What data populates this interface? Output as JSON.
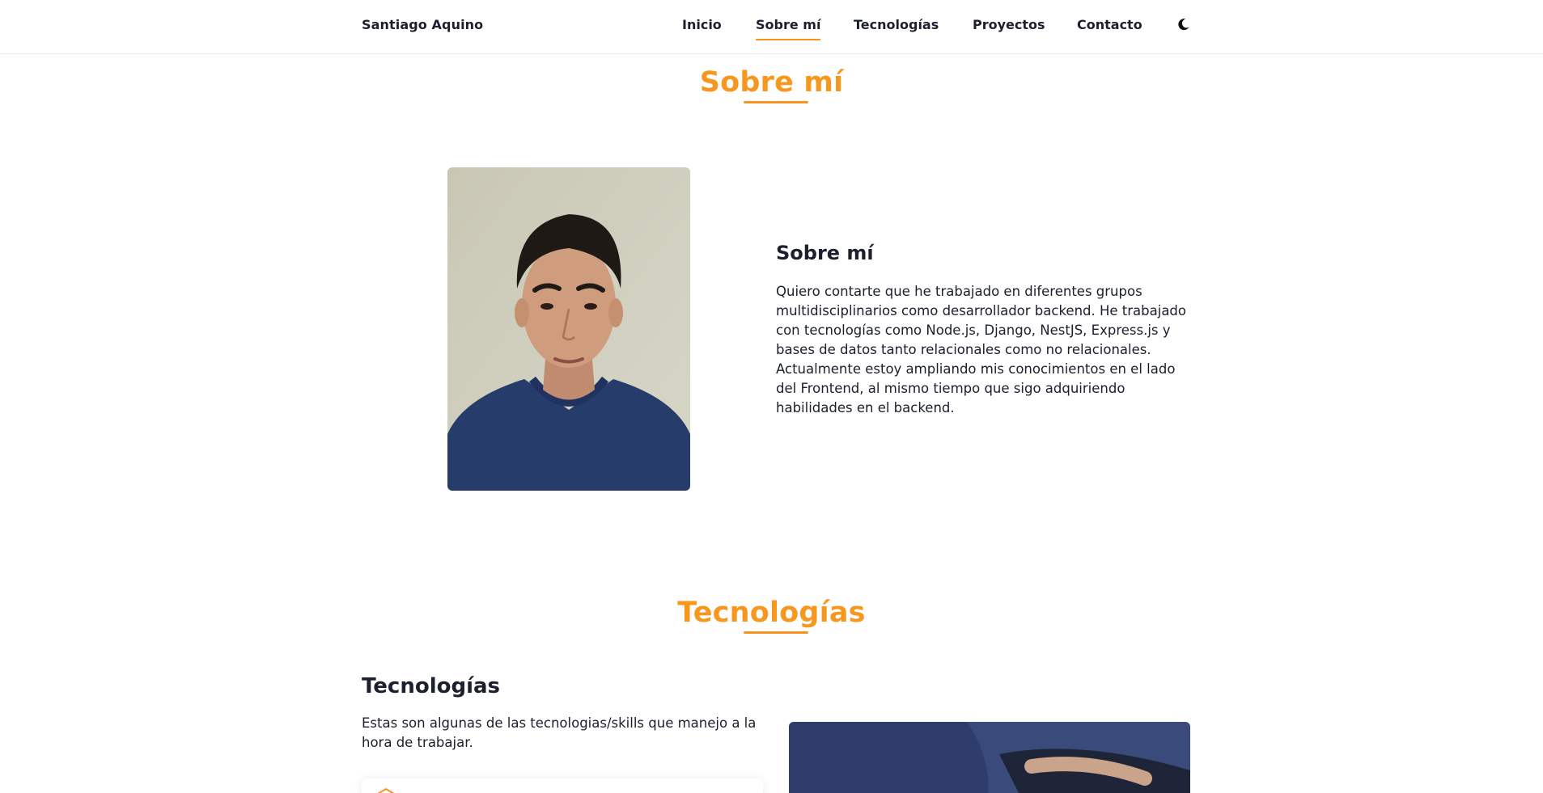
{
  "nav": {
    "brand": "Santiago Aquino",
    "links": [
      {
        "label": "Inicio",
        "active": false
      },
      {
        "label": "Sobre mí",
        "active": true
      },
      {
        "label": "Tecnologías",
        "active": false
      },
      {
        "label": "Proyectos",
        "active": false
      },
      {
        "label": "Contacto",
        "active": false
      }
    ],
    "theme_icon": "moon-icon"
  },
  "about": {
    "section_title": "Sobre mí",
    "heading": "Sobre mí",
    "text": "Quiero contarte que he trabajado en diferentes grupos multidisciplinarios como desarrollador backend. He trabajado con tecnologías como Node.js, Django, NestJS, Express.js y bases de datos tanto relacionales como no relacionales. Actualmente estoy ampliando mis conocimientos en el lado del Frontend, al mismo tiempo que sigo adquiriendo habilidades en el backend."
  },
  "tech": {
    "section_title": "Tecnologías",
    "heading": "Tecnologías",
    "text": "Estas son algunas de las tecnologias/skills que manejo a la hora de trabajar."
  },
  "colors": {
    "accent": "#f7931e",
    "text": "#1b1f2e",
    "background": "#ffffff"
  }
}
